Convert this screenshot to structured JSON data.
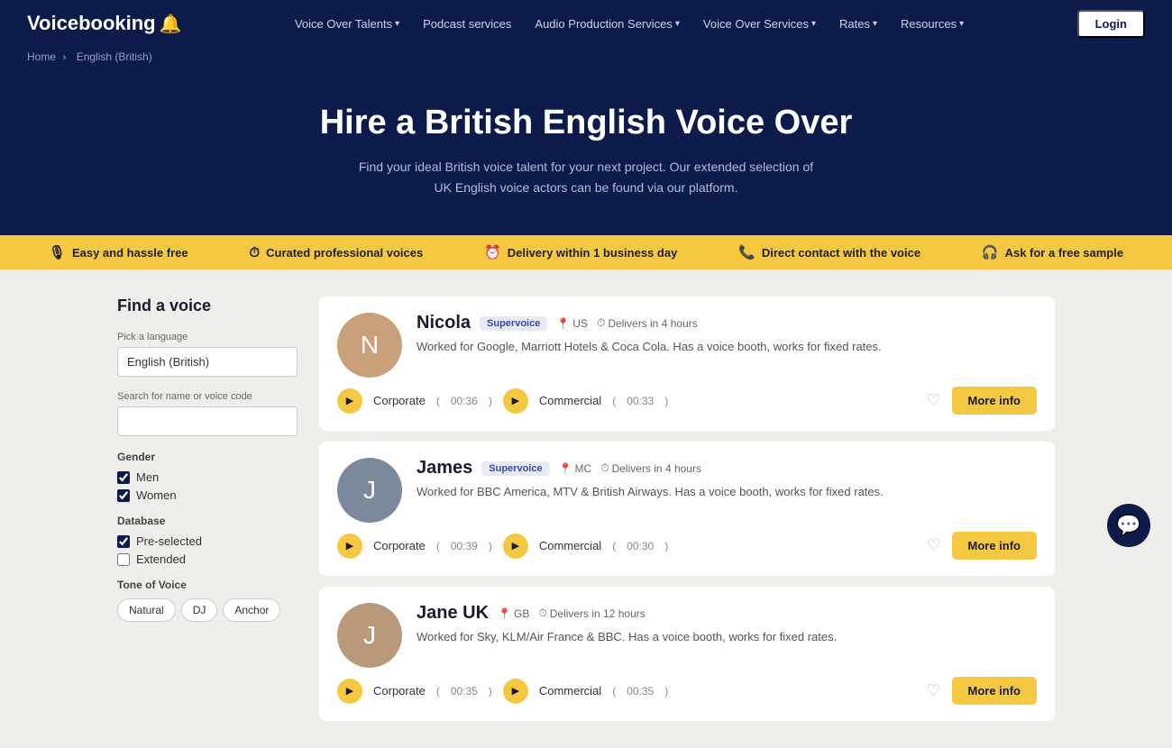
{
  "navbar": {
    "logo": "Voicebooking",
    "logo_icon": "🔔",
    "links": [
      {
        "label": "Voice Over Talents",
        "has_dropdown": true
      },
      {
        "label": "Podcast services",
        "has_dropdown": false
      },
      {
        "label": "Audio Production Services",
        "has_dropdown": true
      },
      {
        "label": "Voice Over Services",
        "has_dropdown": true
      },
      {
        "label": "Rates",
        "has_dropdown": true
      },
      {
        "label": "Resources",
        "has_dropdown": true
      }
    ],
    "login_label": "Login"
  },
  "breadcrumb": {
    "home": "Home",
    "separator": "›",
    "current": "English (British)"
  },
  "hero": {
    "title": "Hire a British English Voice Over",
    "description": "Find your ideal British voice talent for your next project. Our extended selection of UK English voice actors can be found via our platform."
  },
  "features": [
    {
      "icon": "🎙",
      "label": "Easy and hassle free"
    },
    {
      "icon": "⏱",
      "label": "Curated professional voices"
    },
    {
      "icon": "⏰",
      "label": "Delivery within 1 business day"
    },
    {
      "icon": "📞",
      "label": "Direct contact with the voice"
    },
    {
      "icon": "🎧",
      "label": "Ask for a free sample"
    }
  ],
  "sidebar": {
    "title": "Find a voice",
    "language_label": "Pick a language",
    "language_value": "English (British)",
    "search_label": "Search for name or voice code",
    "search_placeholder": "",
    "gender_label": "Gender",
    "genders": [
      {
        "label": "Men",
        "checked": true
      },
      {
        "label": "Women",
        "checked": true
      }
    ],
    "database_label": "Database",
    "databases": [
      {
        "label": "Pre-selected",
        "checked": true
      },
      {
        "label": "Extended",
        "checked": false
      }
    ],
    "tone_label": "Tone of Voice",
    "tones": [
      "Natural",
      "DJ",
      "Anchor"
    ]
  },
  "voices": [
    {
      "id": "nicola",
      "name": "Nicola",
      "badge": "Supervoice",
      "location": "US",
      "delivery": "Delivers in 4 hours",
      "description": "Worked for Google, Marriott Hotels & Coca Cola. Has a voice booth, works for fixed rates.",
      "samples": [
        {
          "type": "Corporate",
          "duration": "00:36"
        },
        {
          "type": "Commercial",
          "duration": "00:33"
        }
      ],
      "avatar_color": "#c9a07a",
      "avatar_letter": "N"
    },
    {
      "id": "james",
      "name": "James",
      "badge": "Supervoice",
      "location": "MC",
      "delivery": "Delivers in 4 hours",
      "description": "Worked for BBC America, MTV & British Airways. Has a voice booth, works for fixed rates.",
      "samples": [
        {
          "type": "Corporate",
          "duration": "00:39"
        },
        {
          "type": "Commercial",
          "duration": "00:30"
        }
      ],
      "avatar_color": "#7a8a9c",
      "avatar_letter": "J"
    },
    {
      "id": "jane-uk",
      "name": "Jane UK",
      "badge": null,
      "location": "GB",
      "delivery": "Delivers in 12 hours",
      "description": "Worked for Sky, KLM/Air France & BBC. Has a voice booth, works for fixed rates.",
      "samples": [
        {
          "type": "Corporate",
          "duration": "00:35"
        },
        {
          "type": "Commercial",
          "duration": "00:35"
        }
      ],
      "avatar_color": "#b89a7a",
      "avatar_letter": "J"
    }
  ],
  "buttons": {
    "more_info": "More info"
  }
}
